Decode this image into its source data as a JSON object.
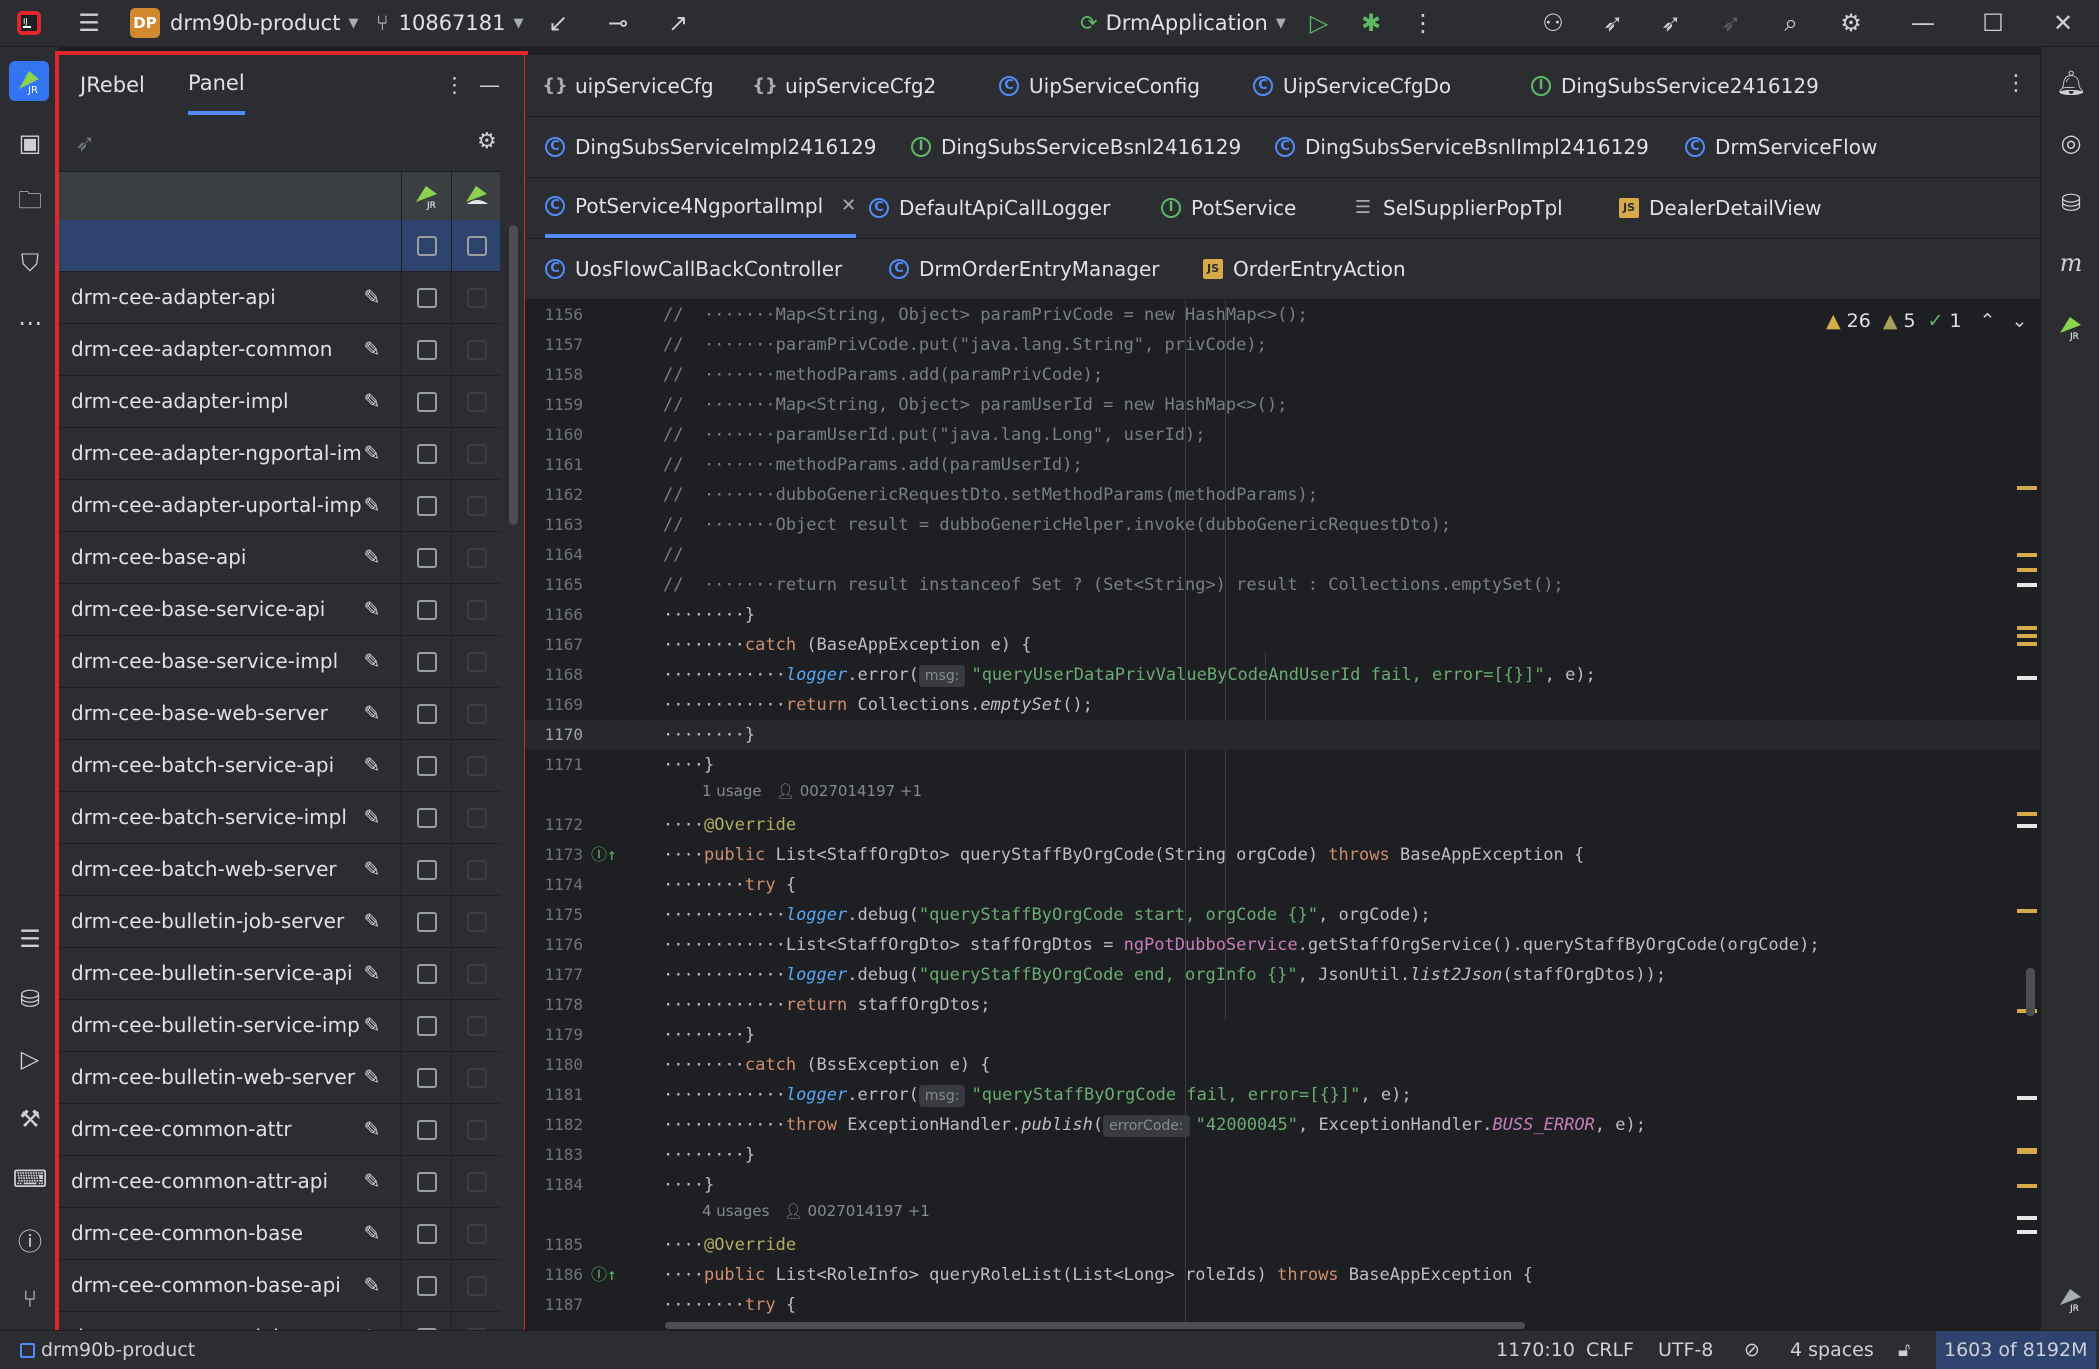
{
  "titlebar": {
    "project_badge": "DP",
    "project_name": "drm90b-product",
    "branch": "10867181",
    "run_config": "DrmApplication"
  },
  "panel": {
    "tab_jrebel": "JRebel",
    "tab_panel": "Panel",
    "rows": [
      "",
      "drm-cee-adapter-api",
      "drm-cee-adapter-common",
      "drm-cee-adapter-impl",
      "drm-cee-adapter-ngportal-impl",
      "drm-cee-adapter-uportal-impl",
      "drm-cee-base-api",
      "drm-cee-base-service-api",
      "drm-cee-base-service-impl",
      "drm-cee-base-web-server",
      "drm-cee-batch-service-api",
      "drm-cee-batch-service-impl",
      "drm-cee-batch-web-server",
      "drm-cee-bulletin-job-server",
      "drm-cee-bulletin-service-api",
      "drm-cee-bulletin-service-impl",
      "drm-cee-bulletin-web-server",
      "drm-cee-common-attr",
      "drm-cee-common-attr-api",
      "drm-cee-common-base",
      "drm-cee-common-base-api",
      "drm-cee-common-job-server"
    ]
  },
  "tabs": {
    "row1": [
      {
        "label": "uipServiceCfg",
        "icon": "braces-icon"
      },
      {
        "label": "uipServiceCfg2",
        "icon": "braces-icon"
      },
      {
        "label": "UipServiceConfig",
        "icon": "class-icon"
      },
      {
        "label": "UipServiceCfgDo",
        "icon": "class-icon"
      },
      {
        "label": "DingSubsService2416129",
        "icon": "interface-icon"
      }
    ],
    "row2": [
      {
        "label": "DingSubsServiceImpl2416129",
        "icon": "class-icon"
      },
      {
        "label": "DingSubsServiceBsnl2416129",
        "icon": "interface-icon"
      },
      {
        "label": "DingSubsServiceBsnlImpl2416129",
        "icon": "class-icon"
      },
      {
        "label": "DrmServiceFlow",
        "icon": "class-icon"
      }
    ],
    "row3": [
      {
        "label": "PotService4NgportalImpl",
        "icon": "class-icon"
      },
      {
        "label": "DefaultApiCallLogger",
        "icon": "class-icon"
      },
      {
        "label": "PotService",
        "icon": "interface-icon"
      },
      {
        "label": "SelSupplierPopTpl",
        "icon": "list-icon"
      },
      {
        "label": "DealerDetailView",
        "icon": "js-icon"
      }
    ],
    "row4": [
      {
        "label": "UosFlowCallBackController",
        "icon": "class-icon"
      },
      {
        "label": "DrmOrderEntryManager",
        "icon": "class-icon"
      },
      {
        "label": "OrderEntryAction",
        "icon": "js-icon"
      }
    ]
  },
  "inspections": {
    "warnings": "26",
    "weak_warnings": "5",
    "ok": "1"
  },
  "code": {
    "lines": [
      {
        "n": "1156",
        "t": "//  ·······Map<String, Object> paramPrivCode = new HashMap<>();"
      },
      {
        "n": "1157",
        "t": "//  ·······paramPrivCode.put(\"java.lang.String\", privCode);"
      },
      {
        "n": "1158",
        "t": "//  ·······methodParams.add(paramPrivCode);"
      },
      {
        "n": "1159",
        "t": "//  ·······Map<String, Object> paramUserId = new HashMap<>();"
      },
      {
        "n": "1160",
        "t": "//  ·······paramUserId.put(\"java.lang.Long\", userId);"
      },
      {
        "n": "1161",
        "t": "//  ·······methodParams.add(paramUserId);"
      },
      {
        "n": "1162",
        "t": "//  ·······dubboGenericRequestDto.setMethodParams(methodParams);"
      },
      {
        "n": "1163",
        "t": "//  ·······Object result = dubboGenericHelper.invoke(dubboGenericRequestDto);"
      },
      {
        "n": "1164",
        "t": "//"
      },
      {
        "n": "1165",
        "t": "//  ·······return result instanceof Set ? (Set<String>) result : Collections.emptySet();"
      },
      {
        "n": "1166",
        "t": "········}"
      },
      {
        "n": "1167",
        "t": "········catch (BaseAppException e) {"
      },
      {
        "n": "1168",
        "t": "············logger.error(  \"queryUserDataPrivValueByCodeAndUserId fail, error=[{}]\", e);"
      },
      {
        "n": "1169",
        "t": "············return Collections.emptySet();"
      },
      {
        "n": "1170",
        "t": "········}"
      },
      {
        "n": "1171",
        "t": "····}"
      },
      {
        "n": "1172",
        "t": "····@Override"
      },
      {
        "n": "1173",
        "t": "····public List<StaffOrgDto> queryStaffByOrgCode(String orgCode) throws BaseAppException {"
      },
      {
        "n": "1174",
        "t": "········try {"
      },
      {
        "n": "1175",
        "t": "············logger.debug(\"queryStaffByOrgCode start, orgCode {}\", orgCode);"
      },
      {
        "n": "1176",
        "t": "············List<StaffOrgDto> staffOrgDtos = ngPotDubboService.getStaffOrgService().queryStaffByOrgCode(orgCode);"
      },
      {
        "n": "1177",
        "t": "············logger.debug(\"queryStaffByOrgCode end, orgInfo {}\", JsonUtil.list2Json(staffOrgDtos));"
      },
      {
        "n": "1178",
        "t": "············return staffOrgDtos;"
      },
      {
        "n": "1179",
        "t": "········}"
      },
      {
        "n": "1180",
        "t": "········catch (BssException e) {"
      },
      {
        "n": "1181",
        "t": "············logger.error(  \"queryStaffByOrgCode fail, error=[{}]\", e);"
      },
      {
        "n": "1182",
        "t": "············throw ExceptionHandler.publish(  \"42000045\", ExceptionHandler.BUSS_ERROR, e);"
      },
      {
        "n": "1183",
        "t": "········}"
      },
      {
        "n": "1184",
        "t": "····}"
      },
      {
        "n": "1185",
        "t": "····@Override"
      },
      {
        "n": "1186",
        "t": "····public List<RoleInfo> queryRoleList(List<Long> roleIds) throws BaseAppException {"
      },
      {
        "n": "1187",
        "t": "········try {"
      }
    ],
    "usage1": "1 usage",
    "author1": "0027014197 +1",
    "usage2": "4 usages",
    "author2": "0027014197 +1",
    "hint_msg": "msg:",
    "hint_errorcode": "errorCode:"
  },
  "status": {
    "project": "drm90b-product",
    "position": "1170:10",
    "line_sep": "CRLF",
    "encoding": "UTF-8",
    "indent": "4 spaces",
    "memory": "1603 of 8192M"
  }
}
